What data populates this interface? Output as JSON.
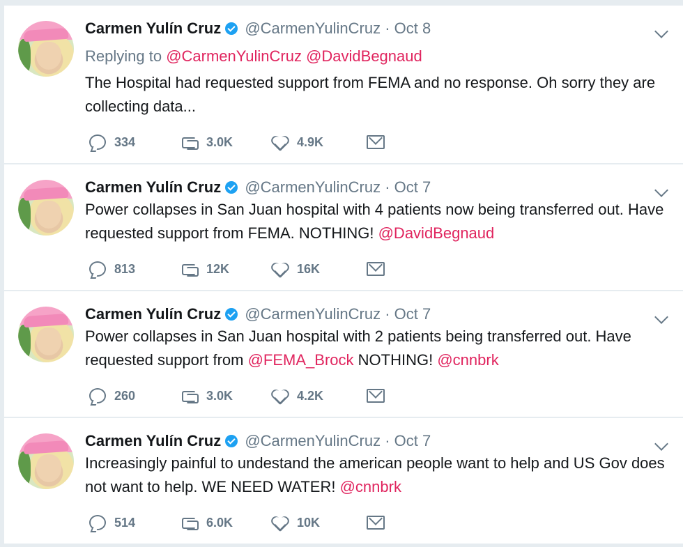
{
  "tweets": [
    {
      "name": "Carmen Yulín Cruz",
      "handle": "@CarmenYulinCruz",
      "separator": "·",
      "time": "Oct 8",
      "reply_prefix": "Replying to",
      "reply_to": [
        "@CarmenYulinCruz",
        "@DavidBegnaud"
      ],
      "text": "The Hospital had requested support from FEMA and no response. Oh sorry they are collecting data...",
      "replies": "334",
      "retweets": "3.0K",
      "likes": "4.9K"
    },
    {
      "name": "Carmen Yulín Cruz",
      "handle": "@CarmenYulinCruz",
      "separator": "·",
      "time": "Oct 7",
      "text_before": "Power collapses in San Juan hospital with 4 patients now  being  transferred out. Have requested support from FEMA. NOTHING!",
      "mention_1": "@DavidBegnaud",
      "replies": "813",
      "retweets": "12K",
      "likes": "16K"
    },
    {
      "name": "Carmen Yulín Cruz",
      "handle": "@CarmenYulinCruz",
      "separator": "·",
      "time": "Oct 7",
      "text_before": "Power collapses in San Juan hospital with 2 patients  being  transferred out. Have requested support from",
      "mention_1": "@FEMA_Brock",
      "text_middle": "NOTHING!",
      "mention_2": "@cnnbrk",
      "replies": "260",
      "retweets": "3.0K",
      "likes": "4.2K"
    },
    {
      "name": "Carmen Yulín Cruz",
      "handle": "@CarmenYulinCruz",
      "separator": "·",
      "time": "Oct 7",
      "text_before": "Increasingly painful to undestand the american people want to help and US Gov does not want to help. WE NEED WATER!",
      "mention_1": "@cnnbrk",
      "replies": "514",
      "retweets": "6.0K",
      "likes": "10K"
    }
  ],
  "icons": {
    "reply": "reply-icon",
    "retweet": "retweet-icon",
    "like": "heart-icon",
    "dm": "mail-icon",
    "more": "chevron-down-icon",
    "verified": "verified-badge-icon"
  },
  "colors": {
    "link": "#e0245e",
    "muted": "#657786",
    "verified": "#1da1f2",
    "background": "#e6ecf0"
  }
}
